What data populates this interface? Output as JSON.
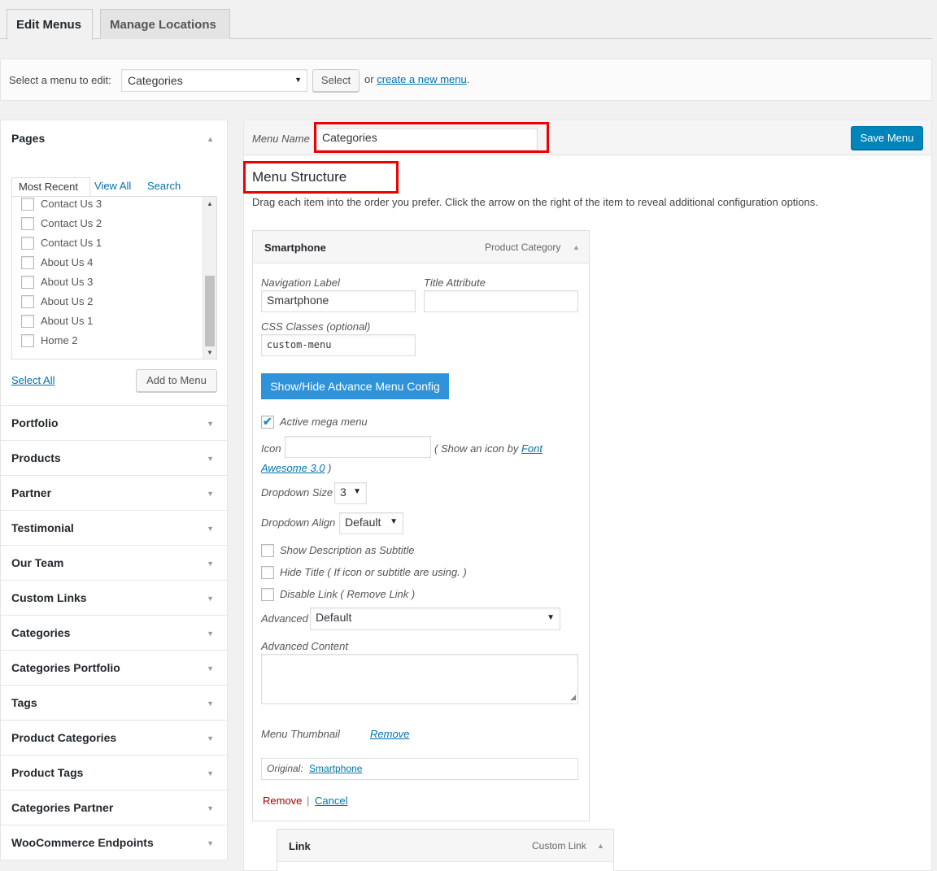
{
  "tabs": {
    "edit_menus": "Edit Menus",
    "manage_locations": "Manage Locations"
  },
  "select_bar": {
    "label": "Select a menu to edit:",
    "selected_menu": "Categories",
    "select_button": "Select",
    "or_text": "or",
    "create_link": "create a new menu",
    "period": "."
  },
  "pages_box": {
    "title": "Pages",
    "tabs": [
      "Most Recent",
      "View All",
      "Search"
    ],
    "items": [
      "Contact Us 3",
      "Contact Us 2",
      "Contact Us 1",
      "About Us 4",
      "About Us 3",
      "About Us 2",
      "About Us 1",
      "Home 2"
    ],
    "select_all": "Select All",
    "add_to_menu": "Add to Menu"
  },
  "accordions": [
    "Portfolio",
    "Products",
    "Partner",
    "Testimonial",
    "Our Team",
    "Custom Links",
    "Categories",
    "Categories Portfolio",
    "Tags",
    "Product Categories",
    "Product Tags",
    "Categories Partner",
    "WooCommerce Endpoints"
  ],
  "menu_editor": {
    "menu_name_label": "Menu Name",
    "menu_name_value": "Categories",
    "save_button": "Save Menu",
    "structure_title": "Menu Structure",
    "instructions": "Drag each item into the order you prefer. Click the arrow on the right of the item to reveal additional configuration options."
  },
  "item1": {
    "title": "Smartphone",
    "type": "Product Category",
    "nav_label_label": "Navigation Label",
    "nav_label_value": "Smartphone",
    "title_attr_label": "Title Attribute",
    "title_attr_value": "",
    "css_label": "CSS Classes (optional)",
    "css_value": "custom-menu",
    "advance_button": "Show/Hide Advance Menu Config",
    "active_mega": "Active mega menu",
    "icon_label": "Icon",
    "icon_hint_pre": "( Show an icon by",
    "icon_link_a": "Font",
    "icon_link_b": "Awesome 3.0",
    "icon_hint_post": ")",
    "dropdown_size_label": "Dropdown Size",
    "dropdown_size_value": "3",
    "dropdown_align_label": "Dropdown Align",
    "dropdown_align_value": "Default",
    "show_desc": "Show Description as Subtitle",
    "hide_title": "Hide Title ( If icon or subtitle are using. )",
    "disable_link": "Disable Link ( Remove Link )",
    "advanced_label": "Advanced",
    "advanced_value": "Default",
    "advanced_content_label": "Advanced Content",
    "thumbnail_label": "Menu Thumbnail",
    "thumbnail_remove": "Remove",
    "original_label": "Original:",
    "original_link": "Smartphone",
    "remove": "Remove",
    "separator": "|",
    "cancel": "Cancel"
  },
  "item2": {
    "title": "Link",
    "type": "Custom Link"
  },
  "colors": {
    "primary": "#0085ba",
    "blue_button": "#2e93db",
    "highlight": "#e00000",
    "remove_red": "#a00000"
  }
}
